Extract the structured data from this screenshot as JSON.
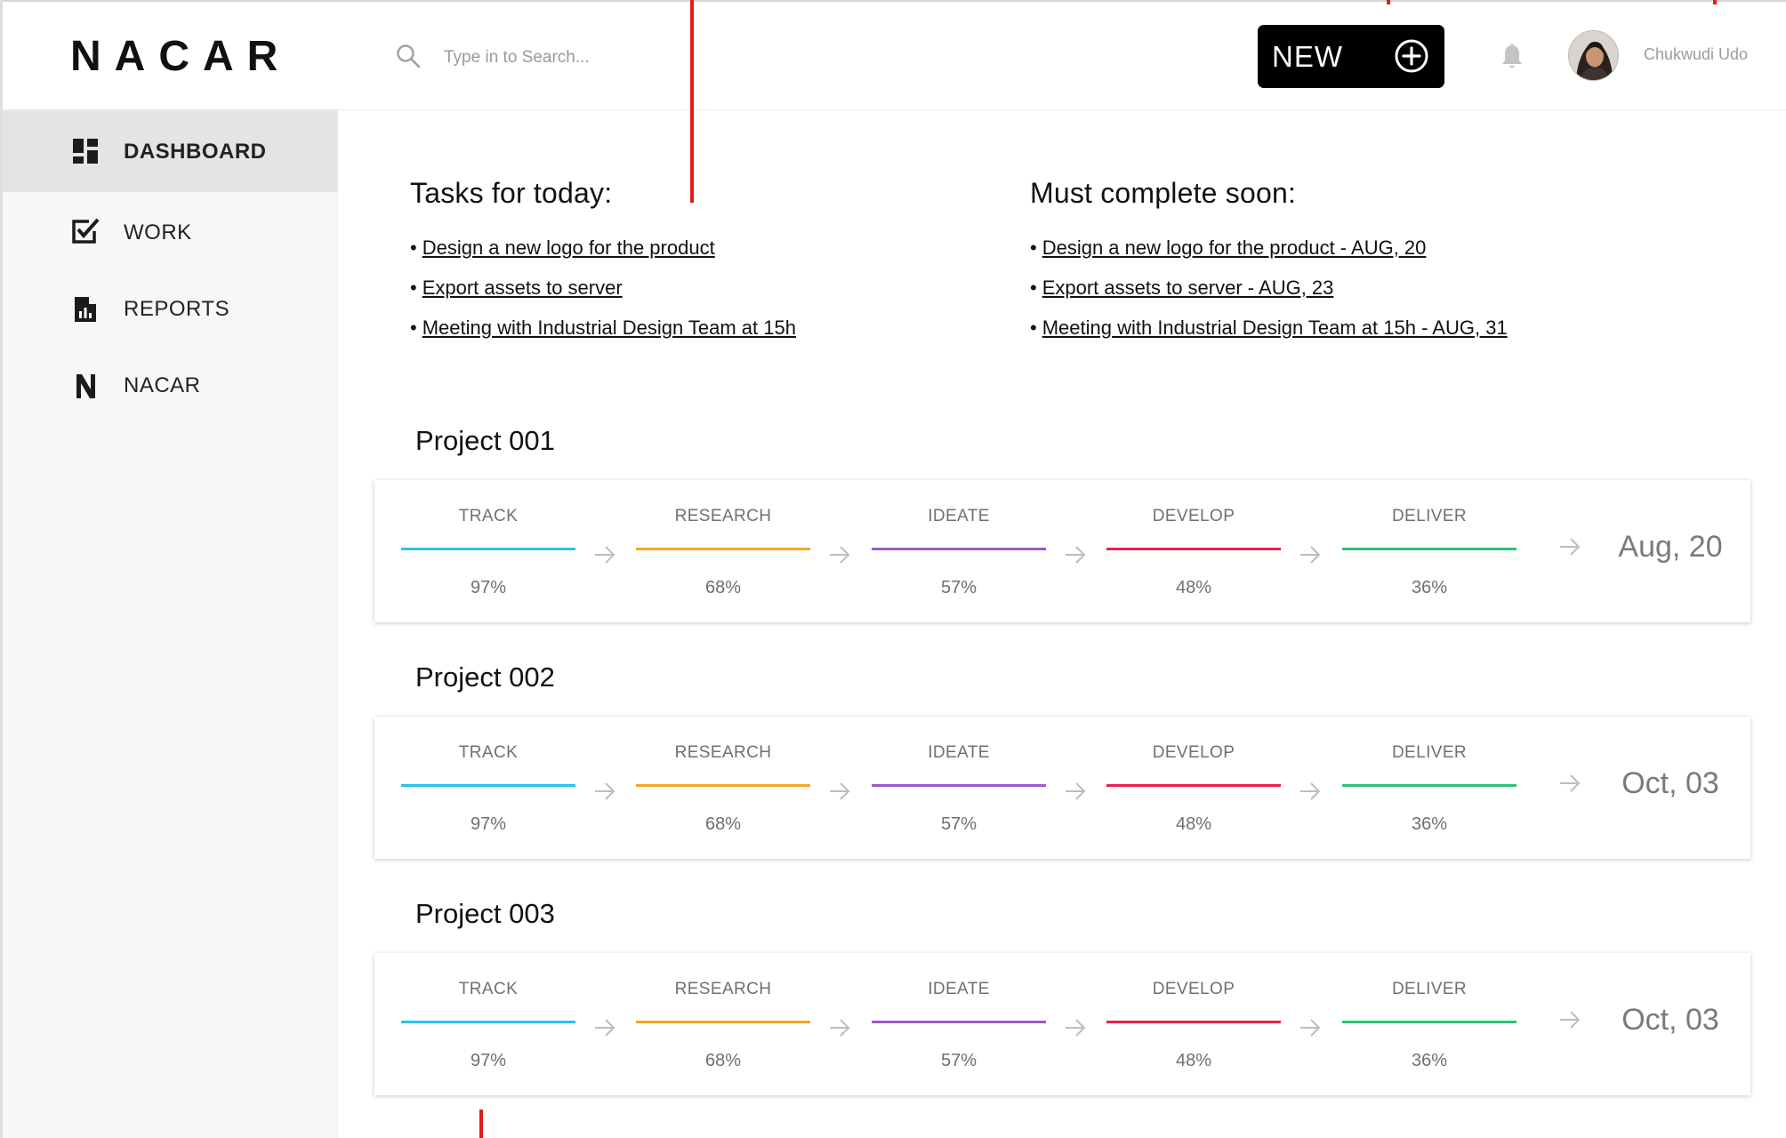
{
  "app": {
    "logo": "NACAR",
    "search_placeholder": "Type in to Search...",
    "new_button_label": "NEW",
    "user_name": "Chukwudi Udo"
  },
  "sidebar": {
    "items": [
      {
        "label": "DASHBOARD",
        "icon": "dashboard-icon",
        "active": true
      },
      {
        "label": "WORK",
        "icon": "checkbox-icon",
        "active": false
      },
      {
        "label": "REPORTS",
        "icon": "report-icon",
        "active": false
      },
      {
        "label": "NACAR",
        "icon": "n-logo-icon",
        "active": false
      }
    ]
  },
  "tasks_today": {
    "heading": "Tasks for today:",
    "items": [
      "Design a new logo for the product",
      "Export assets to server",
      "Meeting with Industrial Design Team at 15h"
    ]
  },
  "must_complete": {
    "heading": "Must complete soon:",
    "items": [
      "Design a new logo for the product - AUG, 20",
      "Export assets to server - AUG, 23",
      "Meeting with Industrial Design Team at 15h - AUG, 31"
    ]
  },
  "stage_colors": [
    "#29c3ec",
    "#f5a623",
    "#9b59c9",
    "#ec1e50",
    "#2dc27a"
  ],
  "projects": [
    {
      "title": "Project 001",
      "due": "Aug, 20",
      "stages": [
        {
          "label": "TRACK",
          "percent": "97%"
        },
        {
          "label": "RESEARCH",
          "percent": "68%"
        },
        {
          "label": "IDEATE",
          "percent": "57%"
        },
        {
          "label": "DEVELOP",
          "percent": "48%"
        },
        {
          "label": "DELIVER",
          "percent": "36%"
        }
      ]
    },
    {
      "title": "Project 002",
      "due": "Oct, 03",
      "stages": [
        {
          "label": "TRACK",
          "percent": "97%"
        },
        {
          "label": "RESEARCH",
          "percent": "68%"
        },
        {
          "label": "IDEATE",
          "percent": "57%"
        },
        {
          "label": "DEVELOP",
          "percent": "48%"
        },
        {
          "label": "DELIVER",
          "percent": "36%"
        }
      ]
    },
    {
      "title": "Project 003",
      "due": "Oct, 03",
      "stages": [
        {
          "label": "TRACK",
          "percent": "97%"
        },
        {
          "label": "RESEARCH",
          "percent": "68%"
        },
        {
          "label": "IDEATE",
          "percent": "57%"
        },
        {
          "label": "DEVELOP",
          "percent": "48%"
        },
        {
          "label": "DELIVER",
          "percent": "36%"
        }
      ]
    }
  ]
}
